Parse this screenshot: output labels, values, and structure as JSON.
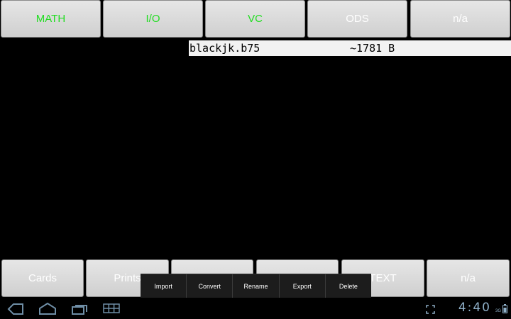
{
  "top_buttons": [
    {
      "label": "MATH"
    },
    {
      "label": "I/O"
    },
    {
      "label": "VC"
    },
    {
      "label": "ODS"
    },
    {
      "label": "n/a"
    }
  ],
  "file_entry": {
    "name": "blackjk.b75",
    "size": "~1781 B"
  },
  "bottom_buttons": [
    {
      "label": "Cards"
    },
    {
      "label": "Prints"
    },
    {
      "label": ""
    },
    {
      "label": ""
    },
    {
      "label": "TEXT"
    },
    {
      "label": "n/a"
    }
  ],
  "context_menu": [
    {
      "label": "Import"
    },
    {
      "label": "Convert"
    },
    {
      "label": "Rename"
    },
    {
      "label": "Export"
    },
    {
      "label": "Delete"
    }
  ],
  "status_bar": {
    "time": "4:40",
    "network": "3G"
  },
  "colors": {
    "accent_green": "#22dd22",
    "clock": "#8fb0c8"
  }
}
